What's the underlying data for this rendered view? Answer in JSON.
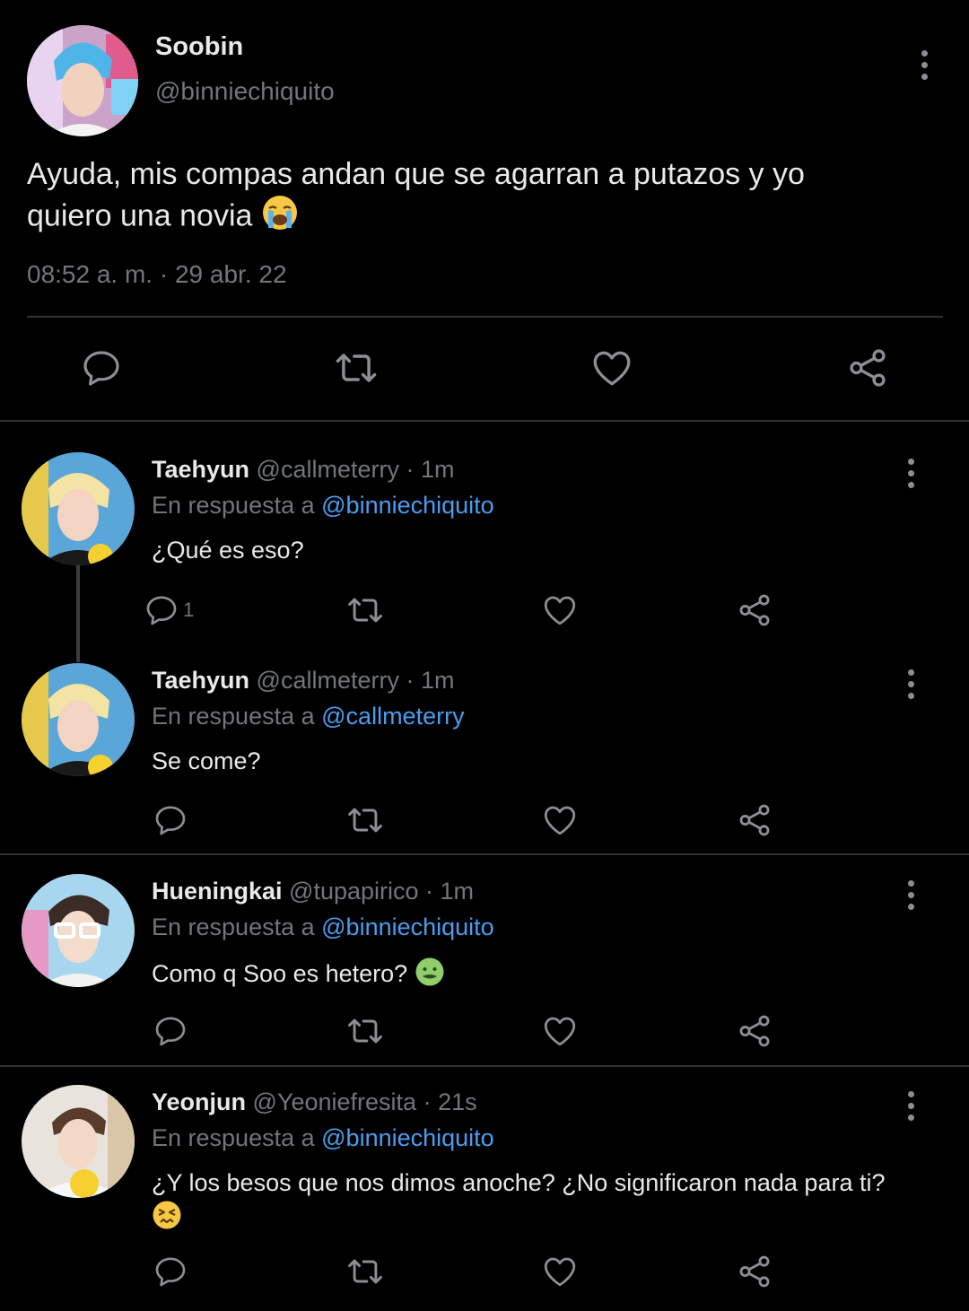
{
  "main_tweet": {
    "name": "Soobin",
    "handle": "@binniechiquito",
    "text_line1": "Ayuda, mis compas andan que se agarran a putazos y yo",
    "text_line2": "quiero una novia",
    "emoji": "loudly-crying-face-emoji",
    "timestamp": "08:52 a. m. · 29 abr. 22",
    "actions": [
      "reply-icon",
      "retweet-icon",
      "like-icon",
      "share-icon"
    ]
  },
  "replies": [
    {
      "name": "Taehyun",
      "handle": "@callmeterry",
      "age": "· 1m",
      "reply_prefix": "En respuesta a",
      "reply_to": "@binniechiquito",
      "text": "¿Qué es eso?",
      "reply_count": "1"
    },
    {
      "name": "Taehyun",
      "handle": "@callmeterry",
      "age": "· 1m",
      "reply_prefix": "En respuesta a",
      "reply_to": "@callmeterry",
      "text": "Se come?"
    },
    {
      "name": "Hueningkai",
      "handle": "@tupapirico",
      "age": "· 1m",
      "reply_prefix": "En respuesta a",
      "reply_to": "@binniechiquito",
      "text": "Como q Soo es hetero?",
      "emoji": "nauseated-face-emoji"
    },
    {
      "name": "Yeonjun",
      "handle": "@Yeoniefresita",
      "age": "· 21s",
      "reply_prefix": "En respuesta a",
      "reply_to": "@binniechiquito",
      "text": "¿Y los besos que nos dimos anoche? ¿No significaron nada para ti?",
      "emoji": "persevering-face-emoji"
    }
  ],
  "colors": {
    "background": "#000000",
    "text": "#e7e9ea",
    "muted": "#71767b",
    "link": "#4a9df0",
    "divider": "#2f3336"
  }
}
